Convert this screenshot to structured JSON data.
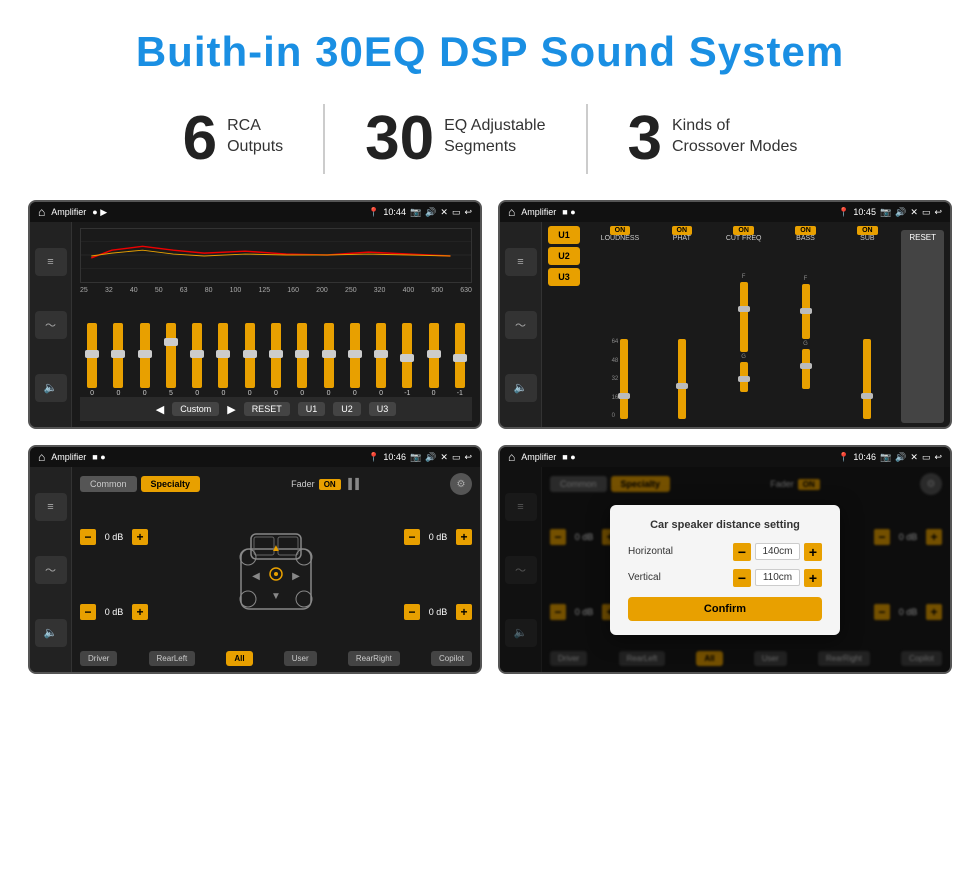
{
  "header": {
    "title": "Buith-in 30EQ DSP Sound System"
  },
  "stats": [
    {
      "number": "6",
      "text_line1": "RCA",
      "text_line2": "Outputs"
    },
    {
      "number": "30",
      "text_line1": "EQ Adjustable",
      "text_line2": "Segments"
    },
    {
      "number": "3",
      "text_line1": "Kinds of",
      "text_line2": "Crossover Modes"
    }
  ],
  "screen1": {
    "statusbar": {
      "app": "Amplifier",
      "time": "10:44"
    },
    "eq_labels": [
      "25",
      "32",
      "40",
      "50",
      "63",
      "80",
      "100",
      "125",
      "160",
      "200",
      "250",
      "320",
      "400",
      "500",
      "630"
    ],
    "eq_values": [
      "0",
      "0",
      "0",
      "5",
      "0",
      "0",
      "0",
      "0",
      "0",
      "0",
      "0",
      "0",
      "-1",
      "0",
      "-1"
    ],
    "buttons": [
      "Custom",
      "RESET",
      "U1",
      "U2",
      "U3"
    ]
  },
  "screen2": {
    "statusbar": {
      "app": "Amplifier",
      "time": "10:45"
    },
    "presets": [
      "U1",
      "U2",
      "U3"
    ],
    "channels": [
      "LOUDNESS",
      "PHAT",
      "CUT FREQ",
      "BASS",
      "SUB"
    ],
    "on_labels": [
      "ON",
      "ON",
      "ON",
      "ON",
      "ON"
    ],
    "reset_label": "RESET"
  },
  "screen3": {
    "statusbar": {
      "app": "Amplifier",
      "time": "10:46"
    },
    "tabs": [
      "Common",
      "Specialty"
    ],
    "fader_label": "Fader",
    "on_label": "ON",
    "db_values": [
      "0 dB",
      "0 dB",
      "0 dB",
      "0 dB"
    ],
    "bottom_btns": [
      "Driver",
      "RearLeft",
      "All",
      "User",
      "RearRight",
      "Copilot"
    ]
  },
  "screen4": {
    "statusbar": {
      "app": "Amplifier",
      "time": "10:46"
    },
    "tabs": [
      "Common",
      "Specialty"
    ],
    "dialog": {
      "title": "Car speaker distance setting",
      "horizontal_label": "Horizontal",
      "horizontal_value": "140cm",
      "vertical_label": "Vertical",
      "vertical_value": "110cm",
      "confirm_label": "Confirm"
    },
    "db_values": [
      "0 dB",
      "0 dB"
    ],
    "bottom_btns": [
      "Driver",
      "RearLeft",
      "All",
      "User",
      "RearRight",
      "Copilot"
    ]
  }
}
